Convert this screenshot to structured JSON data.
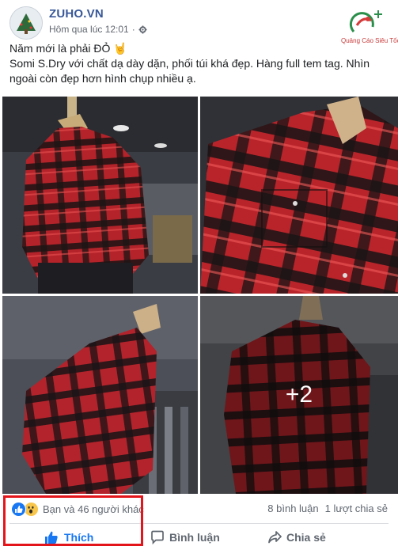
{
  "post": {
    "page_name": "ZUHO.VN",
    "timestamp": "Hôm qua lúc 12:01",
    "privacy_icon": "gear-icon",
    "watermark_text": "Quảng Cáo Siêu Tốc",
    "caption_line1": "Năm mới là phải ĐỎ 🤘",
    "caption_line2": "Somi S.Dry với chất dạ dày dặn, phối túi khá đẹp. Hàng full tem tag. Nhìn ngoài còn đẹp hơn hình chụp nhiều ạ.",
    "more_photos": "+2"
  },
  "stats": {
    "reaction_icons": [
      "like-icon",
      "wow-icon"
    ],
    "reaction_text": "Bạn và 46 người khác",
    "comments": "8 bình luận",
    "shares": "1 lượt chia sẻ"
  },
  "actions": {
    "like": "Thích",
    "comment": "Bình luận",
    "share": "Chia sẻ"
  },
  "colors": {
    "brand": "#385898",
    "like_blue": "#1877f2",
    "highlight": "#e4141b",
    "shirt_red": "#c0282a"
  }
}
